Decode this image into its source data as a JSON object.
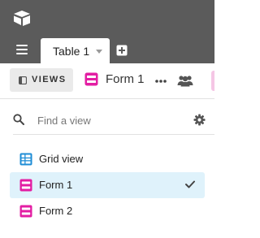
{
  "header": {
    "logo_icon": "airtable-logo-icon",
    "menu_icon": "hamburger-menu-icon",
    "table_tab": {
      "label": "Table 1",
      "caret_icon": "caret-down-icon"
    },
    "add_table_icon": "plus-square-icon"
  },
  "viewbar": {
    "views_button_label": "VIEWS",
    "views_icon": "sidebar-toggle-icon",
    "current_view": {
      "label": "Form 1",
      "icon": "form-view-icon"
    },
    "more_icon": "ellipsis-icon",
    "share_icon": "people-icon"
  },
  "search": {
    "placeholder": "Find a view",
    "value": "",
    "settings_icon": "gear-icon"
  },
  "views": [
    {
      "label": "Grid view",
      "icon": "grid-view-icon",
      "selected": false
    },
    {
      "label": "Form 1",
      "icon": "form-view-icon",
      "selected": true
    },
    {
      "label": "Form 2",
      "icon": "form-view-icon",
      "selected": false
    }
  ],
  "colors": {
    "header_bg": "#5b5b5b",
    "grid_blue": "#1f8dd6",
    "form_pink": "#e31ea3",
    "selected_bg": "#dff2fb"
  }
}
